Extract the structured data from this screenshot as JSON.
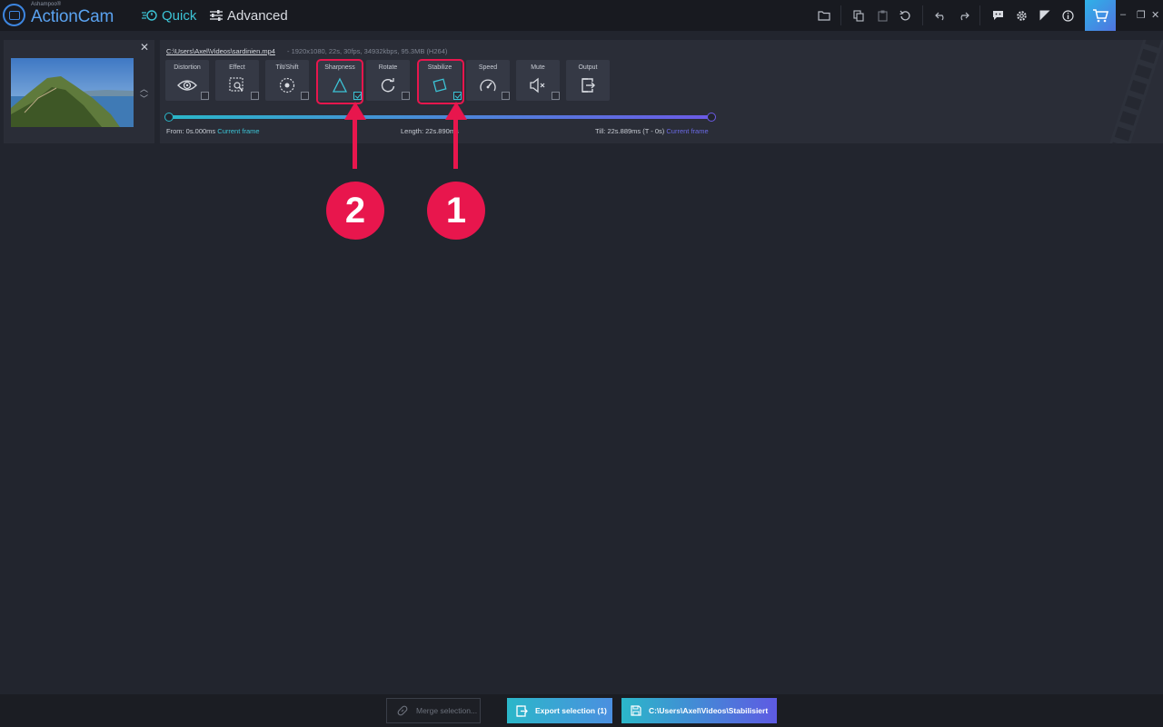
{
  "app": {
    "brand_small": "Ashampoo®",
    "brand": "ActionCam",
    "modes": [
      {
        "label": "Quick",
        "active": true
      },
      {
        "label": "Advanced",
        "active": false
      }
    ]
  },
  "file": {
    "path": "C:\\Users\\Axel\\Videos\\sardinien.mp4",
    "meta": "-  1920x1080, 22s, 30fps, 34932kbps, 95.3MB (H264)"
  },
  "tools": [
    {
      "label": "Distortion",
      "icon": "eye-icon",
      "checked": false
    },
    {
      "label": "Effect",
      "icon": "effect-icon",
      "checked": false
    },
    {
      "label": "Tilt/Shift",
      "icon": "tiltshift-icon",
      "checked": false
    },
    {
      "label": "Sharpness",
      "icon": "triangle-icon",
      "checked": true
    },
    {
      "label": "Rotate",
      "icon": "rotate-icon",
      "checked": false
    },
    {
      "label": "Stabilize",
      "icon": "stabilize-icon",
      "checked": true
    },
    {
      "label": "Speed",
      "icon": "speedometer-icon",
      "checked": false
    },
    {
      "label": "Mute",
      "icon": "mute-icon",
      "checked": false
    },
    {
      "label": "Output",
      "icon": "output-icon",
      "checked": false
    }
  ],
  "timeline": {
    "from_label": "From: 0s.000ms",
    "from_link": "Current frame",
    "length_label": "Length: 22s.890ms",
    "till_label": "Till: 22s.889ms (T - 0s)",
    "till_link": "Current frame"
  },
  "annotations": {
    "badge_1": "1",
    "badge_2": "2"
  },
  "bottom": {
    "merge_label": "Merge selection...",
    "export_label": "Export selection (1)",
    "save_label": "C:\\Users\\Axel\\Videos\\Stabilisiert"
  },
  "colors": {
    "accent": "#3cc4d6",
    "annotation": "#e8164d",
    "background": "#22252e"
  }
}
